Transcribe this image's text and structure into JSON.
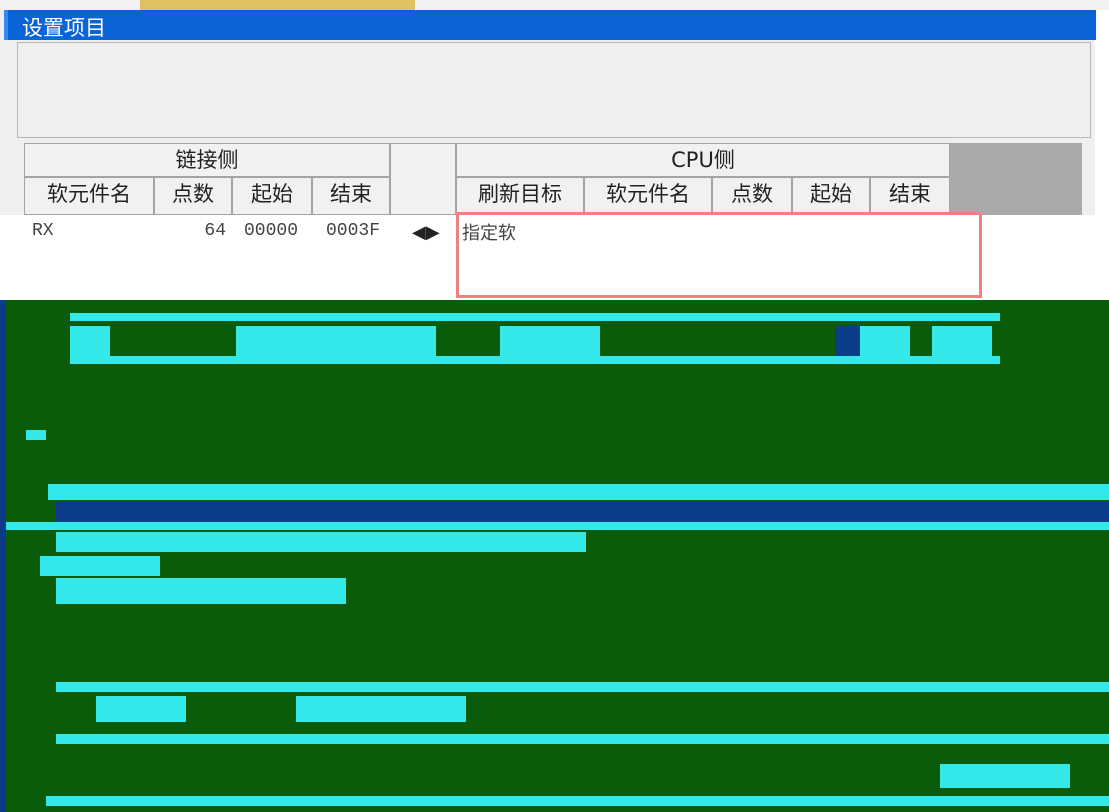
{
  "window": {
    "title": "设置项目"
  },
  "grid": {
    "link_side_header": "链接侧",
    "cpu_side_header": "CPU侧",
    "columns": [
      "软元件名",
      "点数",
      "起始",
      "结束",
      "刷新目标",
      "软元件名",
      "点数",
      "起始",
      "结束"
    ],
    "rows": [
      {
        "device": "RX",
        "points": "64",
        "start": "00000",
        "end": "0003F",
        "refresh_target": "指定软"
      }
    ]
  },
  "colors": {
    "title_bar": "#0a64d8",
    "highlight_border": "#ef8080",
    "corrupt_green": "#0a5c0a",
    "corrupt_cyan": "#33e8e8"
  },
  "icons": {
    "direction": "left-right-arrow-icon"
  }
}
